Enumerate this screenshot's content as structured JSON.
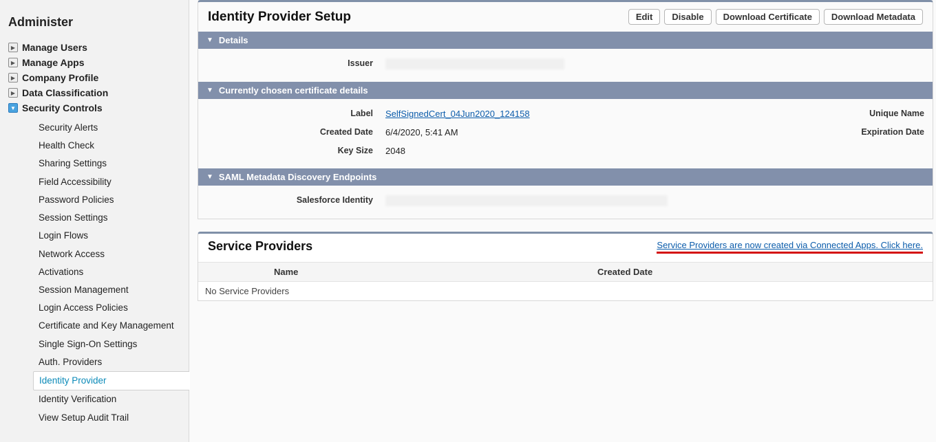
{
  "sidebar": {
    "title": "Administer",
    "items": [
      {
        "label": "Manage Users",
        "open": false
      },
      {
        "label": "Manage Apps",
        "open": false
      },
      {
        "label": "Company Profile",
        "open": false
      },
      {
        "label": "Data Classification",
        "open": false
      },
      {
        "label": "Security Controls",
        "open": true,
        "children": [
          "Security Alerts",
          "Health Check",
          "Sharing Settings",
          "Field Accessibility",
          "Password Policies",
          "Session Settings",
          "Login Flows",
          "Network Access",
          "Activations",
          "Session Management",
          "Login Access Policies",
          "Certificate and Key Management",
          "Single Sign-On Settings",
          "Auth. Providers",
          "Identity Provider",
          "Identity Verification",
          "View Setup Audit Trail"
        ],
        "selected_index": 14
      }
    ]
  },
  "idp": {
    "title": "Identity Provider Setup",
    "buttons": {
      "edit": "Edit",
      "disable": "Disable",
      "download_cert": "Download Certificate",
      "download_meta": "Download Metadata"
    },
    "sections": {
      "details": {
        "title": "Details",
        "issuer_label": "Issuer"
      },
      "cert": {
        "title": "Currently chosen certificate details",
        "label_label": "Label",
        "label_value": "SelfSignedCert_04Jun2020_124158",
        "created_label": "Created Date",
        "created_value": "6/4/2020, 5:41 AM",
        "keysize_label": "Key Size",
        "keysize_value": "2048",
        "unique_label": "Unique Name",
        "expiration_label": "Expiration Date"
      },
      "saml": {
        "title": "SAML Metadata Discovery Endpoints",
        "sf_identity_label": "Salesforce Identity"
      }
    }
  },
  "sp": {
    "title": "Service Providers",
    "link_text": "Service Providers are now created via Connected Apps. Click here.",
    "columns": {
      "blank": "",
      "name": "Name",
      "created": "Created Date"
    },
    "empty_text": "No Service Providers"
  }
}
